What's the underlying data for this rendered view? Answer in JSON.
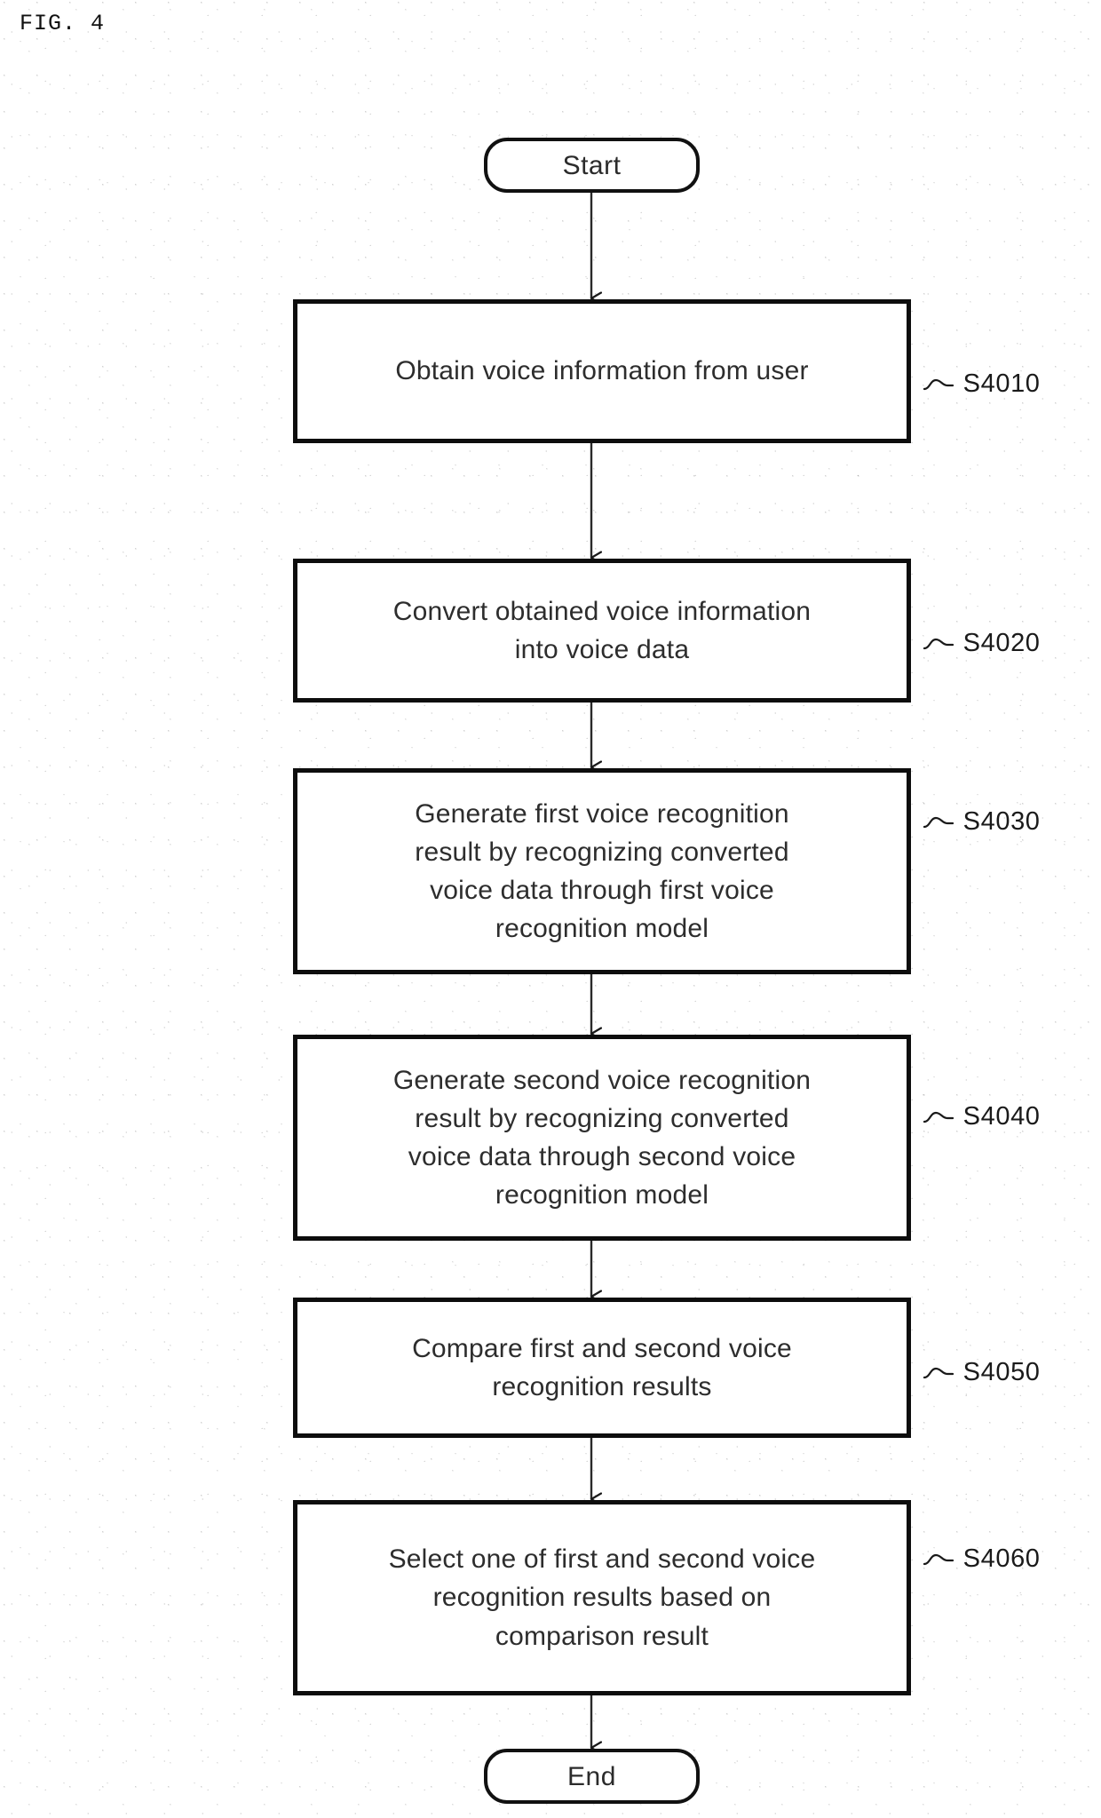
{
  "figure": {
    "title": "FIG. 4",
    "type": "flowchart",
    "orientation": "vertical-top-to-bottom"
  },
  "nodes": [
    {
      "id": "start",
      "shape": "terminator",
      "label": "Start",
      "step_ref": null
    },
    {
      "id": "s4010",
      "shape": "process",
      "label": "Obtain voice information from user",
      "step_ref": "S4010"
    },
    {
      "id": "s4020",
      "shape": "process",
      "label": "Convert obtained voice information\ninto voice data",
      "step_ref": "S4020"
    },
    {
      "id": "s4030",
      "shape": "process",
      "label": "Generate first voice recognition\nresult by recognizing converted\nvoice data through first voice\nrecognition model",
      "step_ref": "S4030"
    },
    {
      "id": "s4040",
      "shape": "process",
      "label": "Generate second voice recognition\nresult by recognizing converted\nvoice data through second voice\nrecognition model",
      "step_ref": "S4040"
    },
    {
      "id": "s4050",
      "shape": "process",
      "label": "Compare first and second voice\nrecognition results",
      "step_ref": "S4050"
    },
    {
      "id": "s4060",
      "shape": "process",
      "label": "Select one of first and second voice\nrecognition results based on\ncomparison result",
      "step_ref": "S4060"
    },
    {
      "id": "end",
      "shape": "terminator",
      "label": "End",
      "step_ref": null
    }
  ],
  "edges": [
    {
      "from": "start",
      "to": "s4010",
      "arrow": "down"
    },
    {
      "from": "s4010",
      "to": "s4020",
      "arrow": "down"
    },
    {
      "from": "s4020",
      "to": "s4030",
      "arrow": "down"
    },
    {
      "from": "s4030",
      "to": "s4040",
      "arrow": "down"
    },
    {
      "from": "s4040",
      "to": "s4050",
      "arrow": "down"
    },
    {
      "from": "s4050",
      "to": "s4060",
      "arrow": "down"
    },
    {
      "from": "s4060",
      "to": "end",
      "arrow": "down"
    }
  ],
  "colors": {
    "stroke": "#0d0d0d",
    "text": "#2d2d2d",
    "background": "#ffffff"
  }
}
